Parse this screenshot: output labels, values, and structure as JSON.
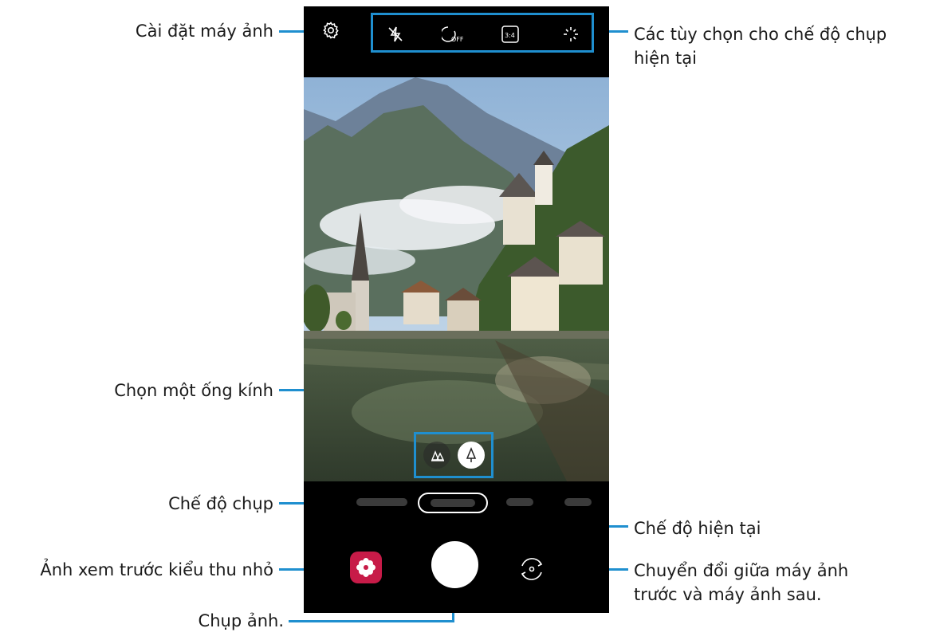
{
  "annotations": {
    "camera_settings": "Cài đặt máy ảnh",
    "current_mode_options_line1": "Các tùy chọn cho chế độ chụp",
    "current_mode_options_line2": "hiện tại",
    "select_lens": "Chọn một ống kính",
    "shooting_modes": "Chế độ chụp",
    "current_mode": "Chế độ hiện tại",
    "thumbnail_preview": "Ảnh xem trước kiểu thu nhỏ",
    "switch_camera_line1": "Chuyển đổi giữa máy ảnh",
    "switch_camera_line2": "trước và máy ảnh sau.",
    "take_picture": "Chụp ảnh."
  },
  "camera": {
    "top_options": [
      {
        "icon": "flash-off-icon"
      },
      {
        "icon": "timer-off-icon",
        "text": "OFF"
      },
      {
        "icon": "ratio-icon",
        "text": "3:4"
      },
      {
        "icon": "filter-effect-icon"
      }
    ],
    "settings_icon": "gear-icon",
    "lenses": [
      {
        "icon": "wide-lens-icon",
        "selected": false
      },
      {
        "icon": "standard-lens-icon",
        "selected": true
      }
    ],
    "shoot_button_icon": "shutter-button",
    "gallery_icon": "gallery-flower-icon",
    "switch_icon": "switch-camera-icon"
  },
  "colors": {
    "annotation_line": "#1f8fcf",
    "gallery_button": "#c71b48",
    "phone_background": "#000000"
  }
}
